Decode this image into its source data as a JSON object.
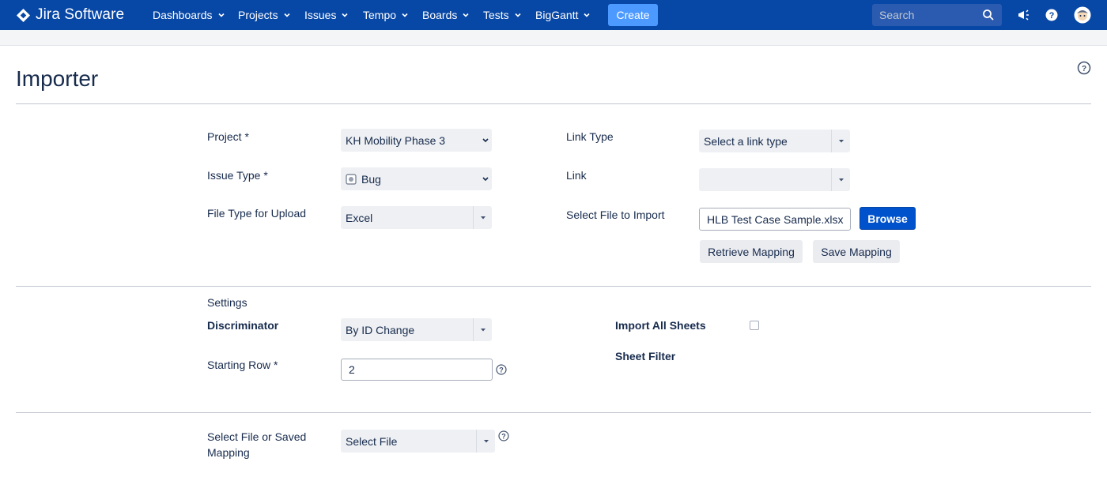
{
  "nav": {
    "brand": "Jira Software",
    "items": [
      {
        "label": "Dashboards"
      },
      {
        "label": "Projects"
      },
      {
        "label": "Issues"
      },
      {
        "label": "Tempo"
      },
      {
        "label": "Boards"
      },
      {
        "label": "Tests"
      },
      {
        "label": "BigGantt"
      }
    ],
    "create_label": "Create",
    "search_placeholder": "Search",
    "icons": [
      "megaphone-icon",
      "help-icon",
      "avatar"
    ]
  },
  "page": {
    "title": "Importer"
  },
  "import_form": {
    "project": {
      "label": "Project *",
      "value": "KH Mobility Phase 3"
    },
    "issue_type": {
      "label": "Issue Type *",
      "value": "Bug"
    },
    "file_type": {
      "label": "File Type for Upload",
      "value": "Excel"
    },
    "link_type": {
      "label": "Link Type",
      "value": "Select a link type"
    },
    "link": {
      "label": "Link",
      "value": ""
    },
    "select_file": {
      "label": "Select File to Import",
      "value": "HLB Test Case Sample.xlsx",
      "browse_label": "Browse"
    },
    "retrieve_mapping_label": "Retrieve Mapping",
    "save_mapping_label": "Save Mapping"
  },
  "settings": {
    "heading": "Settings",
    "discriminator": {
      "label": "Discriminator",
      "value": "By ID Change"
    },
    "starting_row": {
      "label": "Starting Row *",
      "value": "2"
    },
    "import_all_sheets": {
      "label": "Import All Sheets",
      "checked": false
    },
    "sheet_filter": {
      "label": "Sheet Filter"
    }
  },
  "mapping": {
    "label_line1": "Select File or Saved",
    "label_line2": "Mapping",
    "value": "Select File"
  },
  "colors": {
    "nav_bg": "#0747a6",
    "create_bg": "#4c9aff",
    "primary_button": "#0052cc"
  }
}
